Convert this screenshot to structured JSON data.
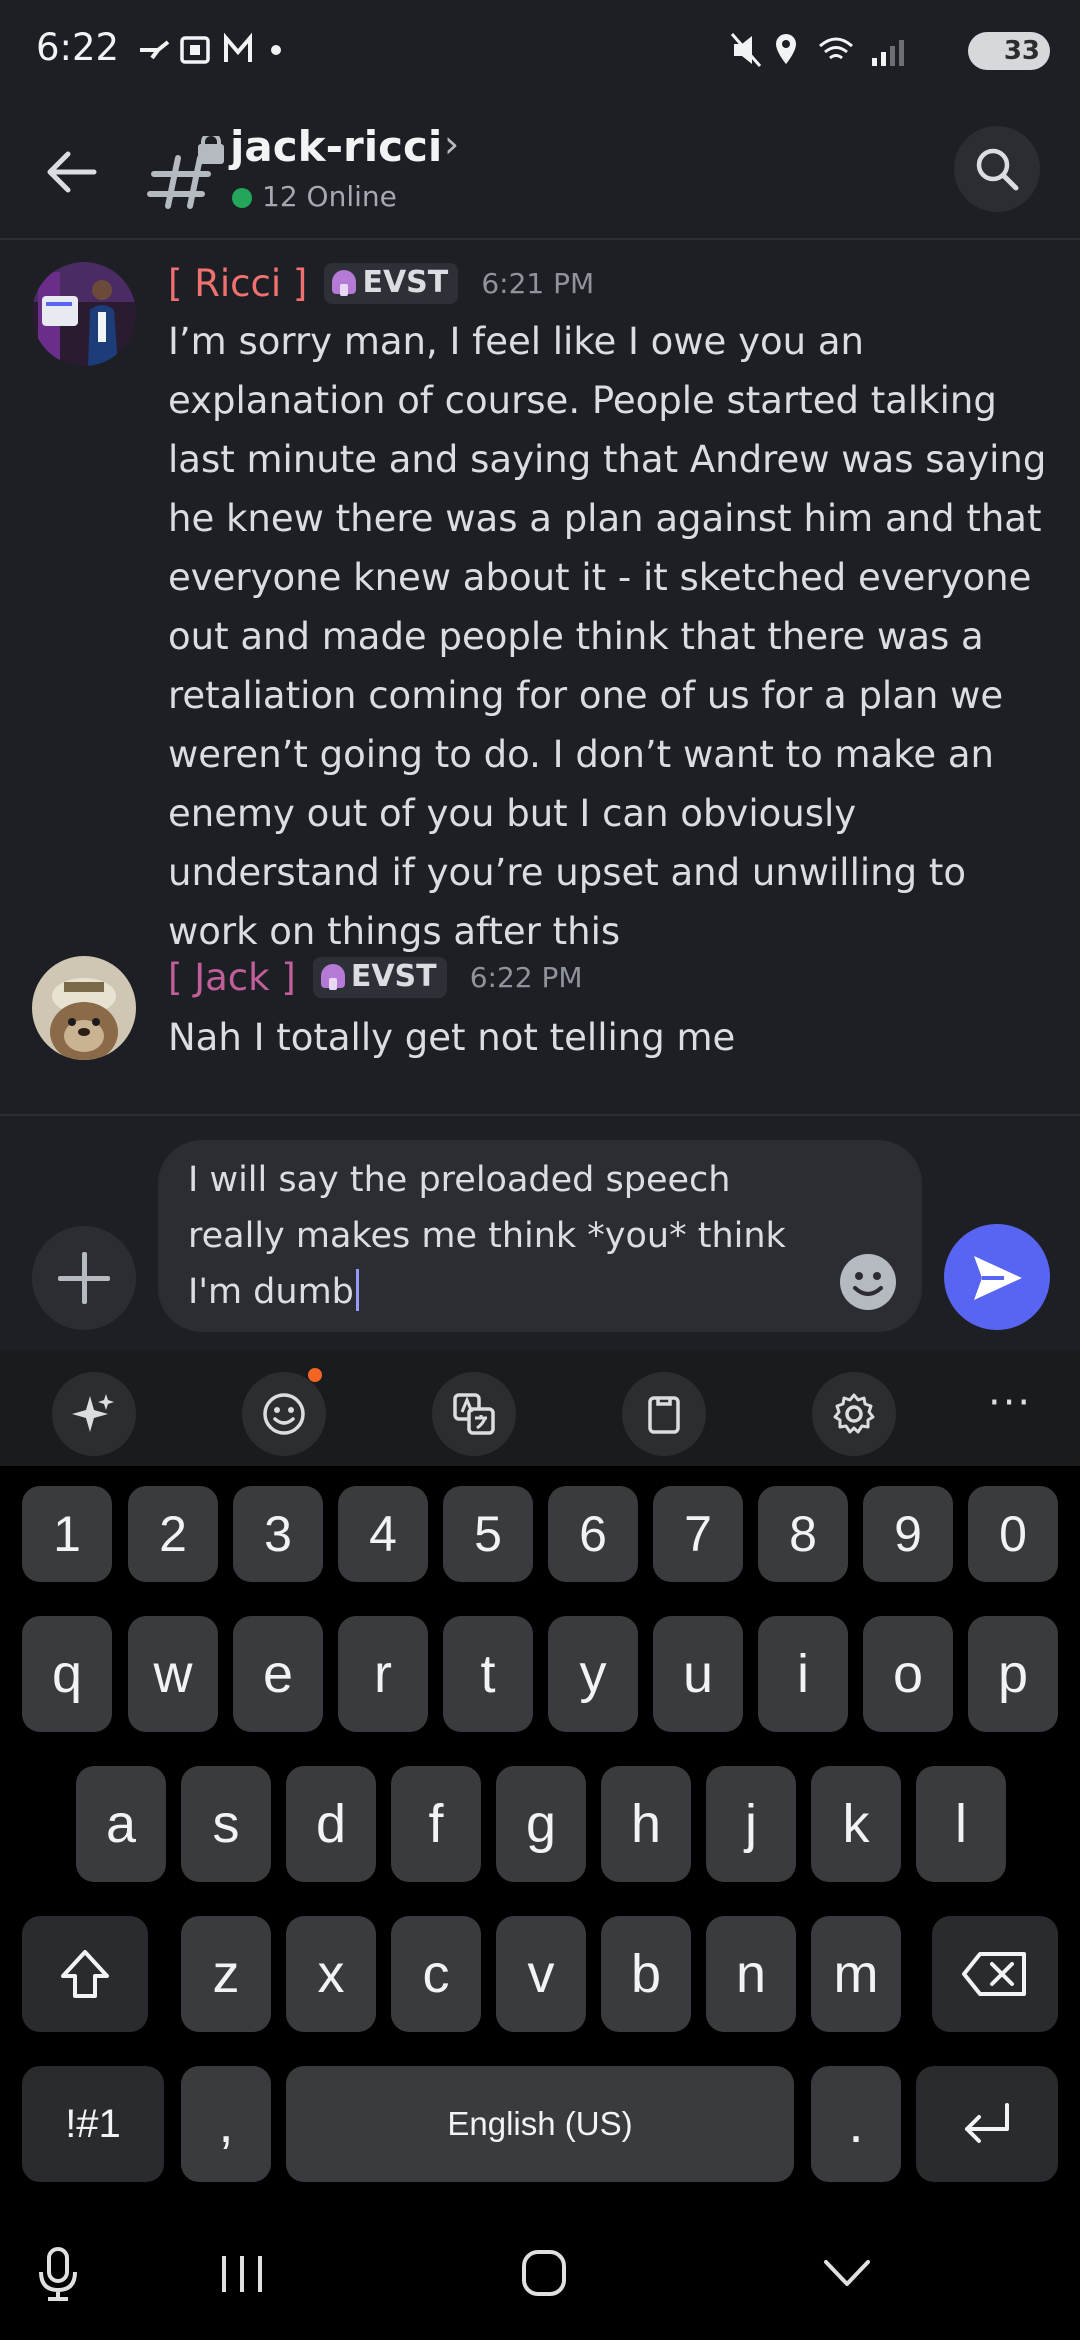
{
  "status_bar": {
    "time": "6:22",
    "left_icons": "⤼ ⧉ M •",
    "right_icons": "🔇 ⬤ ",
    "battery": "33"
  },
  "header": {
    "channel_name": "jack-ricci",
    "chevron": "›",
    "online": "12 Online",
    "icons": [
      "back-arrow-icon",
      "locked-channel-icon",
      "search-icon"
    ]
  },
  "messages": [
    {
      "author": "[ Ricci ]",
      "author_color": "#f0716f",
      "tag": "EVST",
      "time": "6:21 PM",
      "text": "I’m sorry man, I feel like I owe you an explanation of course. People started talking last minute and saying that Andrew was saying he knew there was a plan against him and that everyone knew about it - it sketched everyone out and made people think that there was a retaliation coming for one of us for a plan we weren’t going to do. I don’t want to make an enemy out of you but I can obviously understand if you’re upset and unwilling to work on things after this"
    },
    {
      "author": "[ Jack ]",
      "author_color": "#c15f9b",
      "tag": "EVST",
      "time": "6:22 PM",
      "text": "Nah I totally get not telling me"
    }
  ],
  "composer": {
    "text": "I will say the preloaded speech\nreally makes me think *you* think\nI'm dumb"
  },
  "keyboard": {
    "toolbar_icons": [
      "ai-sparkle-icon",
      "emoji-icon",
      "translate-icon",
      "clipboard-icon",
      "settings-gear-icon",
      "more-icon"
    ],
    "more": "···",
    "row_numbers": [
      "1",
      "2",
      "3",
      "4",
      "5",
      "6",
      "7",
      "8",
      "9",
      "0"
    ],
    "row1": [
      "q",
      "w",
      "e",
      "r",
      "t",
      "y",
      "u",
      "i",
      "o",
      "p"
    ],
    "row2": [
      "a",
      "s",
      "d",
      "f",
      "g",
      "h",
      "j",
      "k",
      "l"
    ],
    "row3": [
      "z",
      "x",
      "c",
      "v",
      "b",
      "n",
      "m"
    ],
    "symbols": "!#1",
    "comma": ",",
    "space": "English (US)",
    "period": "."
  },
  "colors": {
    "background": "#1e1f24",
    "accent": "#5865f2",
    "online": "#23a55a"
  }
}
